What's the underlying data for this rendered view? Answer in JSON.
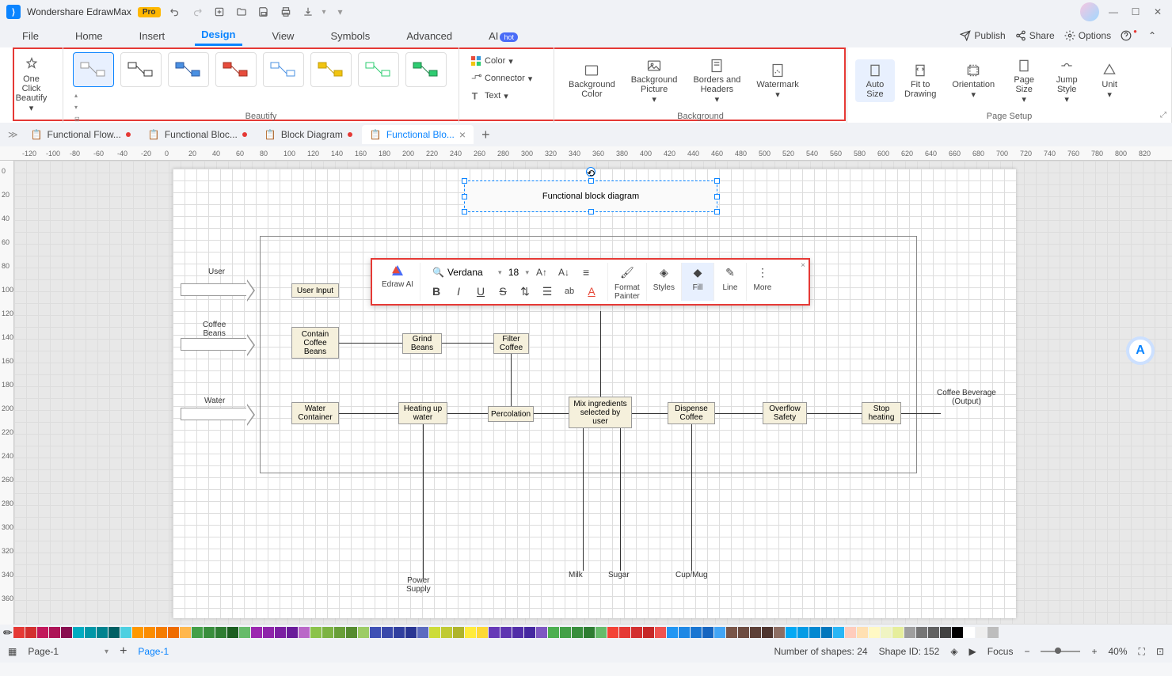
{
  "app": {
    "name": "Wondershare EdrawMax",
    "badge": "Pro"
  },
  "menubar": {
    "items": [
      "File",
      "Home",
      "Insert",
      "Design",
      "View",
      "Symbols",
      "Advanced",
      "AI"
    ],
    "active": "Design",
    "ai_badge": "hot",
    "right": [
      {
        "icon": "publish",
        "label": "Publish"
      },
      {
        "icon": "share",
        "label": "Share"
      },
      {
        "icon": "options",
        "label": "Options"
      }
    ]
  },
  "ribbon": {
    "oneclick": "One Click\nBeautify",
    "beautify_label": "Beautify",
    "color": "Color",
    "connector": "Connector",
    "text": "Text",
    "bg_color": "Background\nColor",
    "bg_pic": "Background\nPicture",
    "borders": "Borders and\nHeaders",
    "watermark": "Watermark",
    "bg_label": "Background",
    "autosize": "Auto\nSize",
    "fit": "Fit to\nDrawing",
    "orientation": "Orientation",
    "pagesize": "Page\nSize",
    "jump": "Jump\nStyle",
    "unit": "Unit",
    "setup_label": "Page Setup"
  },
  "tabs": [
    {
      "label": "Functional Flow...",
      "active": false,
      "dirty": true
    },
    {
      "label": "Functional Bloc...",
      "active": false,
      "dirty": true
    },
    {
      "label": "Block Diagram",
      "active": false,
      "dirty": true
    },
    {
      "label": "Functional Blo...",
      "active": true,
      "dirty": true
    }
  ],
  "ruler_h": [
    -120,
    -100,
    -80,
    -60,
    -40,
    -20,
    0,
    20,
    40,
    60,
    80,
    100,
    120,
    140,
    160,
    180,
    200,
    220,
    240,
    260,
    280,
    300,
    320,
    340,
    360,
    380,
    400,
    420,
    440,
    460,
    480,
    500,
    520,
    540,
    560,
    580,
    600,
    620,
    640,
    660,
    680,
    700,
    720,
    740,
    760,
    780,
    800,
    820
  ],
  "ruler_v": [
    0,
    20,
    40,
    60,
    80,
    100,
    120,
    140,
    160,
    180,
    200,
    220,
    240,
    260,
    280,
    300,
    320,
    340,
    360
  ],
  "diagram": {
    "title": "Functional block diagram",
    "inputs": [
      {
        "l": "User"
      },
      {
        "l": "Coffee\nBeans"
      },
      {
        "l": "Water"
      }
    ],
    "blocks": {
      "user_input": "User Input",
      "contain": "Contain\nCoffee\nBeans",
      "grind": "Grind\nBeans",
      "filter": "Filter\nCoffee",
      "water": "Water\nContainer",
      "heat": "Heating up\nwater",
      "perc": "Percolation",
      "mix": "Mix ingredients\nselected by\nuser",
      "dispense": "Dispense\nCoffee",
      "overflow": "Overflow\nSafety",
      "stop": "Stop\nheating"
    },
    "bottom_labels": [
      "Power\nSupply",
      "Milk",
      "Sugar",
      "Cup/Mug"
    ],
    "output": "Coffee Beverage\n(Output)"
  },
  "float_toolbar": {
    "ai": "Edraw AI",
    "font": "Verdana",
    "size": "18",
    "format": "Format\nPainter",
    "styles": "Styles",
    "fill": "Fill",
    "line": "Line",
    "more": "More"
  },
  "palette": [
    "#e53935",
    "#d32f2f",
    "#c2185b",
    "#ad1457",
    "#880e4f",
    "#00acc1",
    "#0097a7",
    "#00838f",
    "#006064",
    "#4dd0e1",
    "#ff9800",
    "#fb8c00",
    "#f57c00",
    "#ef6c00",
    "#ffb74d",
    "#43a047",
    "#388e3c",
    "#2e7d32",
    "#1b5e20",
    "#66bb6a",
    "#9c27b0",
    "#8e24aa",
    "#7b1fa2",
    "#6a1b9a",
    "#ba68c8",
    "#8bc34a",
    "#7cb342",
    "#689f38",
    "#558b2f",
    "#9ccc65",
    "#3f51b5",
    "#3949ab",
    "#303f9f",
    "#283593",
    "#5c6bc0",
    "#cddc39",
    "#c0ca33",
    "#afb42b",
    "#ffeb3b",
    "#fdd835",
    "#673ab7",
    "#5e35b1",
    "#512da8",
    "#4527a0",
    "#7e57c2",
    "#4caf50",
    "#43a047",
    "#388e3c",
    "#2e7d32",
    "#66bb6a",
    "#f44336",
    "#e53935",
    "#d32f2f",
    "#c62828",
    "#ef5350",
    "#2196f3",
    "#1e88e5",
    "#1976d2",
    "#1565c0",
    "#42a5f5",
    "#795548",
    "#6d4c41",
    "#5d4037",
    "#4e342e",
    "#8d6e63",
    "#03a9f4",
    "#039be5",
    "#0288d1",
    "#0277bd",
    "#29b6f6",
    "#ffccbc",
    "#ffe0b2",
    "#fff9c4",
    "#f0f4c3",
    "#e6ee9c",
    "#9e9e9e",
    "#757575",
    "#616161",
    "#424242",
    "#000000",
    "#ffffff",
    "#eeeeee",
    "#bdbdbd"
  ],
  "status": {
    "shapes": "Number of shapes: 24",
    "shapeid": "Shape ID: 152",
    "focus": "Focus",
    "zoom": "40%",
    "page": "Page-1",
    "page_active": "Page-1"
  }
}
